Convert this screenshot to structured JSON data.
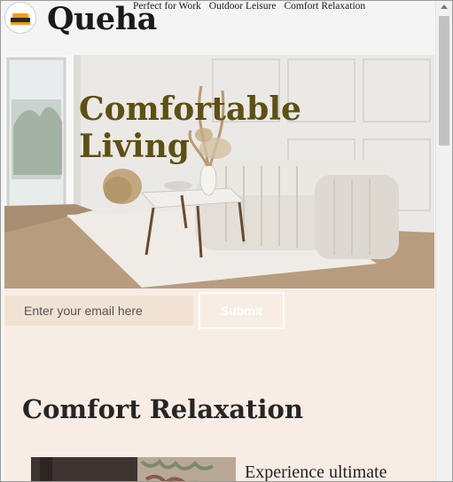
{
  "header": {
    "brand": "Queha",
    "logo_icon": "sofa-icon",
    "nav": [
      "Perfect for Work",
      "Outdoor Leisure",
      "Comfort Relaxation"
    ]
  },
  "hero": {
    "title_line1": "Comfortable",
    "title_line2": "Living",
    "title_color": "#5e5012",
    "image": "living-room-photo"
  },
  "signup": {
    "email_placeholder": "Enter your email here",
    "submit_label": "Submit"
  },
  "section": {
    "title": "Comfort Relaxation",
    "feature_text": "Experience ultimate",
    "feature_image": "bedroom-photo"
  },
  "colors": {
    "band_background": "#f7ede4",
    "input_background": "#f2e2d3",
    "logo_accent": "#ff9a1a"
  }
}
